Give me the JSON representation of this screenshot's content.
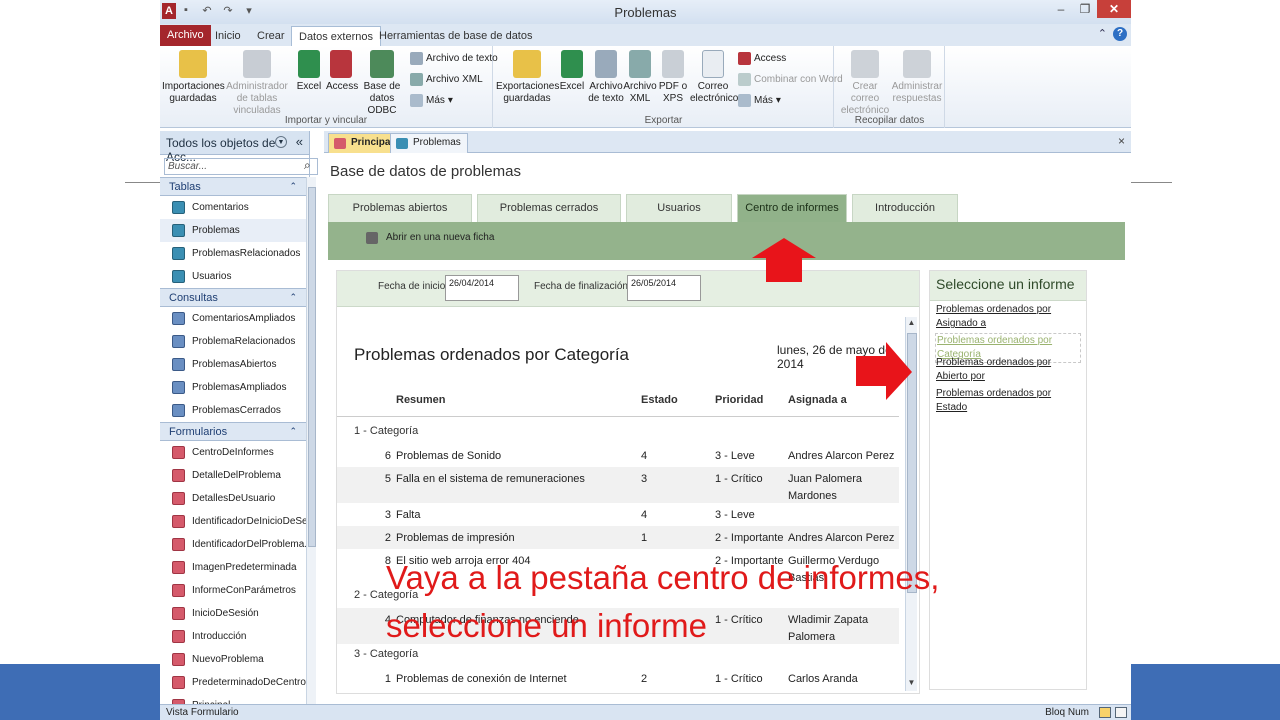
{
  "window": {
    "title": "Problemas",
    "app_icon": "A"
  },
  "ribbon_tabs": [
    "Archivo",
    "Inicio",
    "Crear",
    "Datos externos",
    "Herramientas de base de datos"
  ],
  "ribbon": {
    "import_group": {
      "label": "Importar y vincular",
      "buttons": [
        "Importaciones guardadas",
        "Administrador de tablas vinculadas",
        "Excel",
        "Access",
        "Base de datos ODBC"
      ],
      "small": [
        "Archivo de texto",
        "Archivo XML",
        "Más"
      ]
    },
    "export_group": {
      "label": "Exportar",
      "buttons": [
        "Exportaciones guardadas",
        "Excel",
        "Archivo de texto",
        "Archivo XML",
        "PDF o XPS",
        "Correo electrónico"
      ],
      "small": [
        "Access",
        "Combinar con Word",
        "Más"
      ]
    },
    "collect_group": {
      "label": "Recopilar datos",
      "buttons": [
        "Crear correo electrónico",
        "Administrar respuestas"
      ]
    }
  },
  "nav_pane": {
    "title": "Todos los objetos de Acc...",
    "search_placeholder": "Buscar...",
    "sections": [
      {
        "name": "Tablas",
        "type": "table",
        "items": [
          "Comentarios",
          "Problemas",
          "ProblemasRelacionados",
          "Usuarios"
        ]
      },
      {
        "name": "Consultas",
        "type": "query",
        "items": [
          "ComentariosAmpliados",
          "ProblemaRelacionados",
          "ProblemasAbiertos",
          "ProblemasAmpliados",
          "ProblemasCerrados"
        ]
      },
      {
        "name": "Formularios",
        "type": "form",
        "items": [
          "CentroDeInformes",
          "DetalleDelProblema",
          "DetallesDeUsuario",
          "IdentificadorDeInicioDeSe...",
          "IdentificadorDelProblema...",
          "ImagenPredeterminada",
          "InformeConParámetros",
          "InicioDeSesión",
          "Introducción",
          "NuevoProblema",
          "PredeterminadoDeCentro...",
          "Principal"
        ]
      }
    ]
  },
  "doc_tabs": [
    "Principal",
    "Problemas"
  ],
  "form": {
    "title": "Base de datos de problemas",
    "nav_tabs": [
      "Problemas abiertos",
      "Problemas cerrados",
      "Usuarios",
      "Centro de informes",
      "Introducción"
    ],
    "open_new": "Abrir en una nueva ficha",
    "start_label": "Fecha de inicio",
    "start_value": "26/04/2014",
    "end_label": "Fecha de finalización",
    "end_value": "26/05/2014"
  },
  "report": {
    "title": "Problemas ordenados por Categoría",
    "date": "lunes, 26 de mayo de 2014",
    "columns": [
      "Resumen",
      "Estado",
      "Prioridad",
      "Asignada a"
    ],
    "groups": [
      {
        "name": "1 - Categoría",
        "rows": [
          {
            "id": "6",
            "summary": "Problemas de Sonido",
            "status": "4",
            "priority": "3 - Leve",
            "assigned": "Andres Alarcon Perez"
          },
          {
            "id": "5",
            "summary": "Falla en el sistema de remuneraciones",
            "status": "3",
            "priority": "1 - Crítico",
            "assigned": "Juan Palomera Mardones"
          },
          {
            "id": "3",
            "summary": "Falta",
            "status": "4",
            "priority": "3 - Leve",
            "assigned": ""
          },
          {
            "id": "2",
            "summary": "Problemas de impresión",
            "status": "1",
            "priority": "2 - Importante",
            "assigned": "Andres Alarcon Perez"
          },
          {
            "id": "8",
            "summary": "El sitio web arroja error 404",
            "status": "",
            "priority": "2 - Importante",
            "assigned": "Guillermo Verdugo Bastias"
          }
        ]
      },
      {
        "name": "2 - Categoría",
        "rows": [
          {
            "id": "4",
            "summary": "Computador de finanzas no enciende",
            "status": "",
            "priority": "1 - Crítico",
            "assigned": "Wladimir Zapata Palomera"
          }
        ]
      },
      {
        "name": "3 - Categoría",
        "rows": [
          {
            "id": "1",
            "summary": "Problemas de conexión de Internet",
            "status": "2",
            "priority": "1 - Crítico",
            "assigned": "Carlos Aranda"
          }
        ]
      }
    ]
  },
  "report_pane": {
    "title": "Seleccione un informe",
    "links": [
      "Problemas ordenados por Asignado a",
      "Problemas ordenados por Categoría",
      "Problemas ordenados por Abierto por",
      "Problemas ordenados por Estado"
    ]
  },
  "statusbar": {
    "left": "Vista Formulario",
    "right": "Bloq Num"
  },
  "overlay": {
    "line1": "Vaya a la pestaña centro de informes,",
    "line2": "seleccione un informe",
    "color": "#e01a1a"
  },
  "colors": {
    "accent_green": "#91b28a",
    "file_tab": "#a4262c",
    "slide_band": "#3e6db5"
  }
}
